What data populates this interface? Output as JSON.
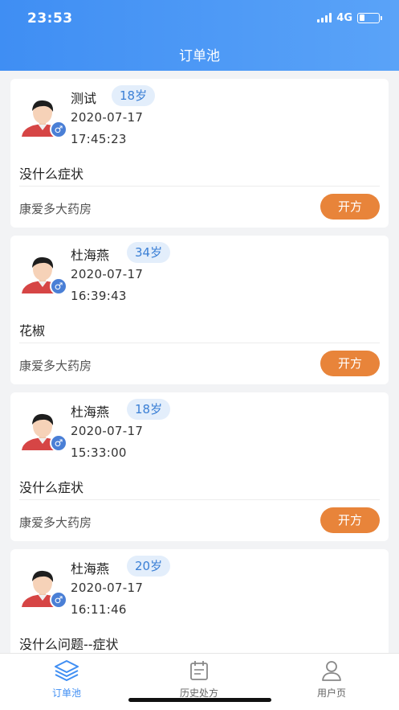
{
  "status_bar": {
    "time": "23:53",
    "network": "4G"
  },
  "header": {
    "title": "订单池"
  },
  "orders": [
    {
      "name": "测试",
      "age": "18岁",
      "date": "2020-07-17",
      "time": "17:45:23",
      "symptom": "没什么症状",
      "pharmacy": "康爱多大药房",
      "action": "开方",
      "gender_icon": "♂"
    },
    {
      "name": "杜海燕",
      "age": "34岁",
      "date": "2020-07-17",
      "time": "16:39:43",
      "symptom": "花椒",
      "pharmacy": "康爱多大药房",
      "action": "开方",
      "gender_icon": "♂"
    },
    {
      "name": "杜海燕",
      "age": "18岁",
      "date": "2020-07-17",
      "time": "15:33:00",
      "symptom": "没什么症状",
      "pharmacy": "康爱多大药房",
      "action": "开方",
      "gender_icon": "♂"
    },
    {
      "name": "杜海燕",
      "age": "20岁",
      "date": "2020-07-17",
      "time": "16:11:46",
      "symptom": "没什么问题--症状",
      "pharmacy": "",
      "action": "",
      "gender_icon": "♂"
    }
  ],
  "tabs": [
    {
      "label": "订单池",
      "icon": "layers-icon",
      "active": true
    },
    {
      "label": "历史处方",
      "icon": "calendar-icon",
      "active": false
    },
    {
      "label": "用户页",
      "icon": "user-icon",
      "active": false
    }
  ],
  "colors": {
    "primary": "#3f8ef3",
    "action": "#e8843a",
    "age_pill": "#e3eefb"
  }
}
